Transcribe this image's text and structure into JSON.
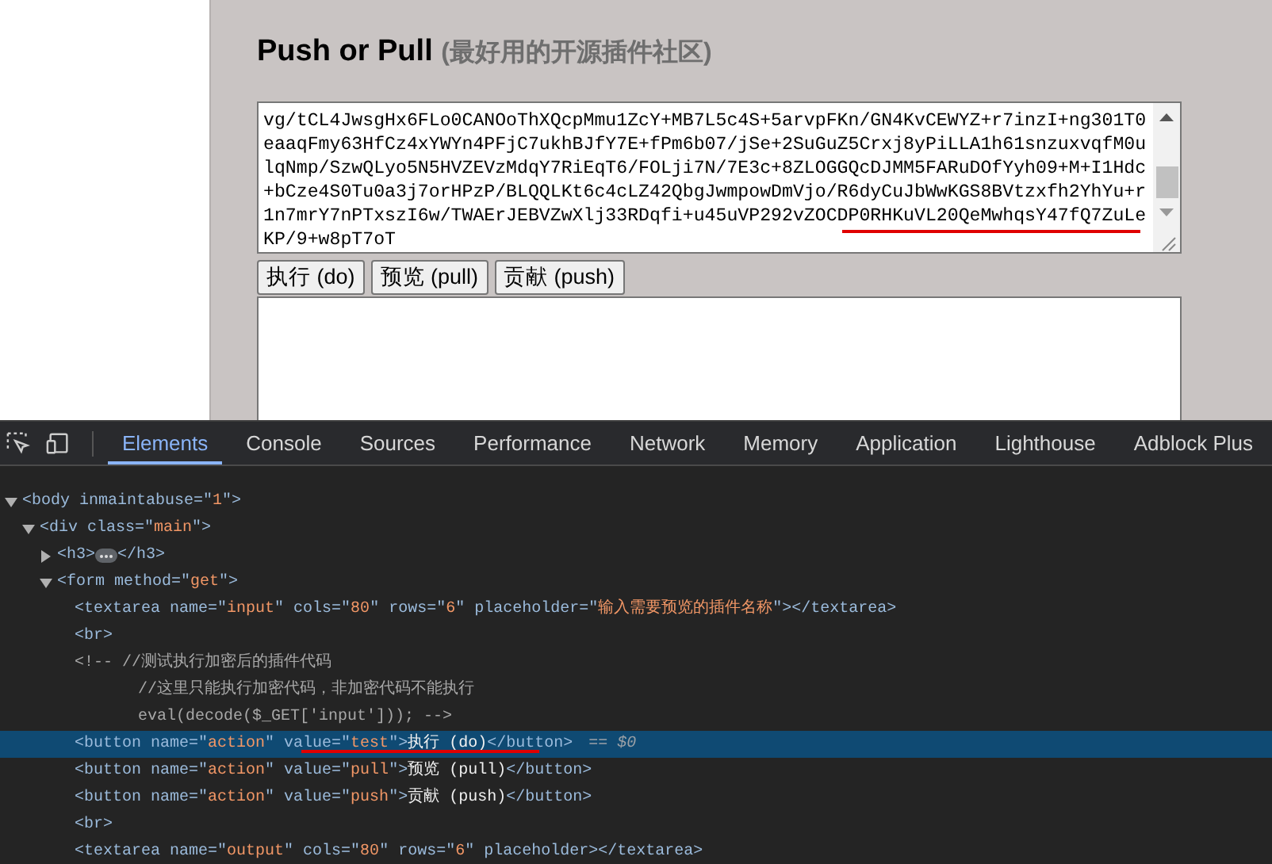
{
  "page": {
    "title": "Push or Pull",
    "subtitle": "(最好用的开源插件社区)",
    "input": {
      "lines": [
        "vg/tCL4JwsgHx6FLo0CANOoThXQcpMmu1ZcY+MB7L5c4S+5arvpFKn/GN4KvCEWYZ+r7inzI+ng301T0",
        "eaaqFmy63HfCz4xYWYn4PFjC7ukhBJfY7E+fPm6b07/jSe+2SuGuZ5Crxj8yPiLLA1h61snzuxvqfM0u",
        "lqNmp/SzwQLyo5N5HVZEVzMdqY7RiEqT6/FOLji7N/7E3c+8ZLOGGQcDJMM5FARuDOfYyh09+M+I1Hdc",
        "+bCze4S0Tu0a3j7orHPzP/BLQQLKt6c4cLZ42QbgJwmpowDmVjo/R6dyCuJbWwKGS8BVtzxfh2YhYu+r",
        "1n7mrY7nPTxszI6w/TWAErJEBVZwXlj33RDqfi+u45uVP292vZOCDP0RHKuVL20QeMwhqsY47fQ7ZuLe",
        "KP/9+w8pT7oT"
      ],
      "annotation_underline": true
    },
    "buttons": [
      "执行 (do)",
      "预览 (pull)",
      "贡献 (push)"
    ]
  },
  "devtools": {
    "annotation_underline": true,
    "tabs": [
      {
        "label": "Elements",
        "selected": true
      },
      {
        "label": "Console",
        "selected": false
      },
      {
        "label": "Sources",
        "selected": false
      },
      {
        "label": "Performance",
        "selected": false
      },
      {
        "label": "Network",
        "selected": false
      },
      {
        "label": "Memory",
        "selected": false
      },
      {
        "label": "Application",
        "selected": false
      },
      {
        "label": "Lighthouse",
        "selected": false
      },
      {
        "label": "Adblock Plus",
        "selected": false
      }
    ],
    "tree": [
      {
        "kind": "element",
        "expanded": true,
        "selected": false,
        "parts": [
          {
            "kind": "tag",
            "text": "<body inmaintabuse=\""
          },
          {
            "kind": "value",
            "text": "1"
          },
          {
            "kind": "tag",
            "text": "\">"
          }
        ],
        "children": [
          {
            "kind": "element",
            "expanded": true,
            "selected": false,
            "parts": [
              {
                "kind": "tag",
                "text": "<div class=\""
              },
              {
                "kind": "value",
                "text": "main"
              },
              {
                "kind": "tag",
                "text": "\">"
              }
            ],
            "children": [
              {
                "kind": "element",
                "expanded": false,
                "selected": false,
                "parts": [
                  {
                    "kind": "tag",
                    "text": "<h3>"
                  },
                  {
                    "kind": "ellipsis"
                  },
                  {
                    "kind": "tag",
                    "text": "</h3>"
                  }
                ]
              },
              {
                "kind": "element",
                "expanded": true,
                "selected": false,
                "parts": [
                  {
                    "kind": "tag",
                    "text": "<form method=\""
                  },
                  {
                    "kind": "value",
                    "text": "get"
                  },
                  {
                    "kind": "tag",
                    "text": "\">"
                  }
                ],
                "children": [
                  {
                    "kind": "leaf",
                    "selected": false,
                    "parts": [
                      {
                        "kind": "tag",
                        "text": "<textarea name=\""
                      },
                      {
                        "kind": "value",
                        "text": "input"
                      },
                      {
                        "kind": "tag",
                        "text": "\" cols=\""
                      },
                      {
                        "kind": "value",
                        "text": "80"
                      },
                      {
                        "kind": "tag",
                        "text": "\" rows=\""
                      },
                      {
                        "kind": "value",
                        "text": "6"
                      },
                      {
                        "kind": "tag",
                        "text": "\" placeholder=\""
                      },
                      {
                        "kind": "value",
                        "text": "输入需要预览的插件名称"
                      },
                      {
                        "kind": "tag",
                        "text": "\"></textarea>"
                      }
                    ]
                  },
                  {
                    "kind": "leaf",
                    "selected": false,
                    "parts": [
                      {
                        "kind": "tag",
                        "text": "<br>"
                      }
                    ]
                  },
                  {
                    "kind": "comment",
                    "selected": false,
                    "lines": [
                      "<!-- //测试执行加密后的插件代码",
                      "//这里只能执行加密代码，非加密代码不能执行",
                      "eval(decode($_GET['input'])); -->"
                    ]
                  },
                  {
                    "kind": "leaf",
                    "selected": true,
                    "parts": [
                      {
                        "kind": "tag",
                        "text": "<button name=\""
                      },
                      {
                        "kind": "value",
                        "text": "action"
                      },
                      {
                        "kind": "tag",
                        "text": "\" value=\""
                      },
                      {
                        "kind": "value",
                        "text": "test"
                      },
                      {
                        "kind": "tag",
                        "text": "\">"
                      },
                      {
                        "kind": "text",
                        "text": "执行 (do)"
                      },
                      {
                        "kind": "tag",
                        "text": "</button>"
                      },
                      {
                        "kind": "ref",
                        "text": "== $0"
                      }
                    ]
                  },
                  {
                    "kind": "leaf",
                    "selected": false,
                    "parts": [
                      {
                        "kind": "tag",
                        "text": "<button name=\""
                      },
                      {
                        "kind": "value",
                        "text": "action"
                      },
                      {
                        "kind": "tag",
                        "text": "\" value=\""
                      },
                      {
                        "kind": "value",
                        "text": "pull"
                      },
                      {
                        "kind": "tag",
                        "text": "\">"
                      },
                      {
                        "kind": "text",
                        "text": "预览 (pull)"
                      },
                      {
                        "kind": "tag",
                        "text": "</button>"
                      }
                    ]
                  },
                  {
                    "kind": "leaf",
                    "selected": false,
                    "parts": [
                      {
                        "kind": "tag",
                        "text": "<button name=\""
                      },
                      {
                        "kind": "value",
                        "text": "action"
                      },
                      {
                        "kind": "tag",
                        "text": "\" value=\""
                      },
                      {
                        "kind": "value",
                        "text": "push"
                      },
                      {
                        "kind": "tag",
                        "text": "\">"
                      },
                      {
                        "kind": "text",
                        "text": "贡献 (push)"
                      },
                      {
                        "kind": "tag",
                        "text": "</button>"
                      }
                    ]
                  },
                  {
                    "kind": "leaf",
                    "selected": false,
                    "parts": [
                      {
                        "kind": "tag",
                        "text": "<br>"
                      }
                    ]
                  },
                  {
                    "kind": "leaf",
                    "selected": false,
                    "parts": [
                      {
                        "kind": "tag",
                        "text": "<textarea name=\""
                      },
                      {
                        "kind": "value",
                        "text": "output"
                      },
                      {
                        "kind": "tag",
                        "text": "\" cols=\""
                      },
                      {
                        "kind": "value",
                        "text": "80"
                      },
                      {
                        "kind": "tag",
                        "text": "\" rows=\""
                      },
                      {
                        "kind": "value",
                        "text": "6"
                      },
                      {
                        "kind": "tag",
                        "text": "\" placeholder></textarea>"
                      }
                    ]
                  }
                ]
              }
            ]
          }
        ]
      }
    ]
  }
}
